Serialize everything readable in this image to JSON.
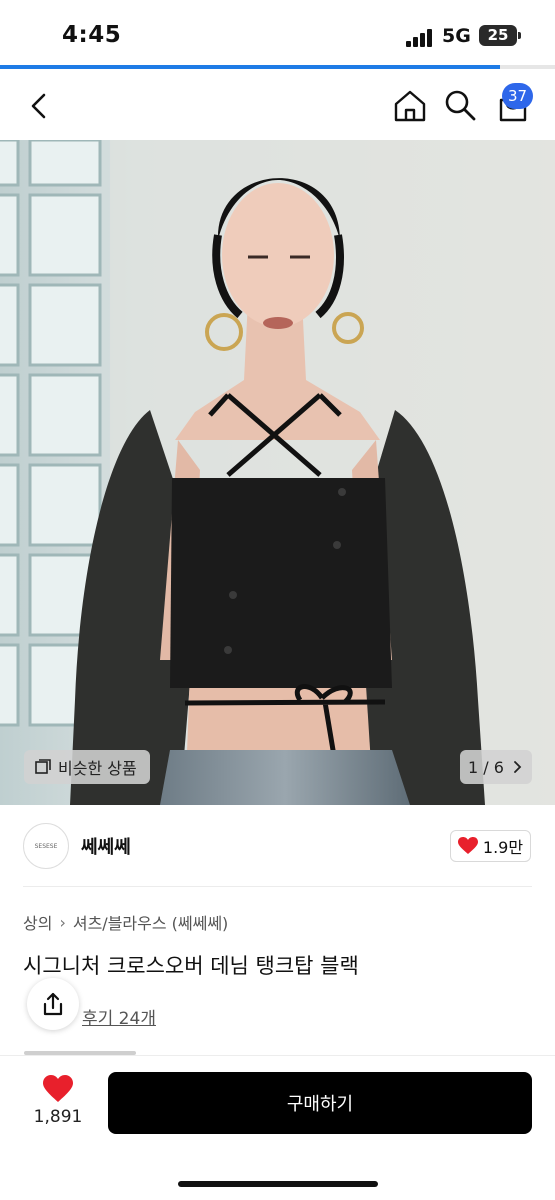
{
  "status_bar": {
    "time": "4:45",
    "network": "5G",
    "battery": "25",
    "icons": [
      "signal-icon",
      "battery-icon"
    ]
  },
  "page_load_progress": 0.9,
  "nav": {
    "icons": [
      "back-icon",
      "home-icon",
      "search-icon",
      "cart-icon"
    ],
    "cart_count": "37"
  },
  "gallery": {
    "similar_label": "비슷한 상품",
    "pager": "1 / 6"
  },
  "brand": {
    "name": "쎄쎄쎄",
    "logo_text": "SESESE",
    "likes": "1.9만"
  },
  "product": {
    "breadcrumb": [
      "상의",
      "셔츠/블라우스 (쎄쎄쎄)"
    ],
    "title": "시그니처 크로스오버 데님 탱크탑 블랙",
    "review_link": "후기 24개"
  },
  "bottom_bar": {
    "wish_count": "1,891",
    "buy_label": "구매하기"
  },
  "colors": {
    "accent": "#2e67ea",
    "progress": "#1e7be6",
    "heart": "#e8202c",
    "buy_button": "#000000"
  }
}
